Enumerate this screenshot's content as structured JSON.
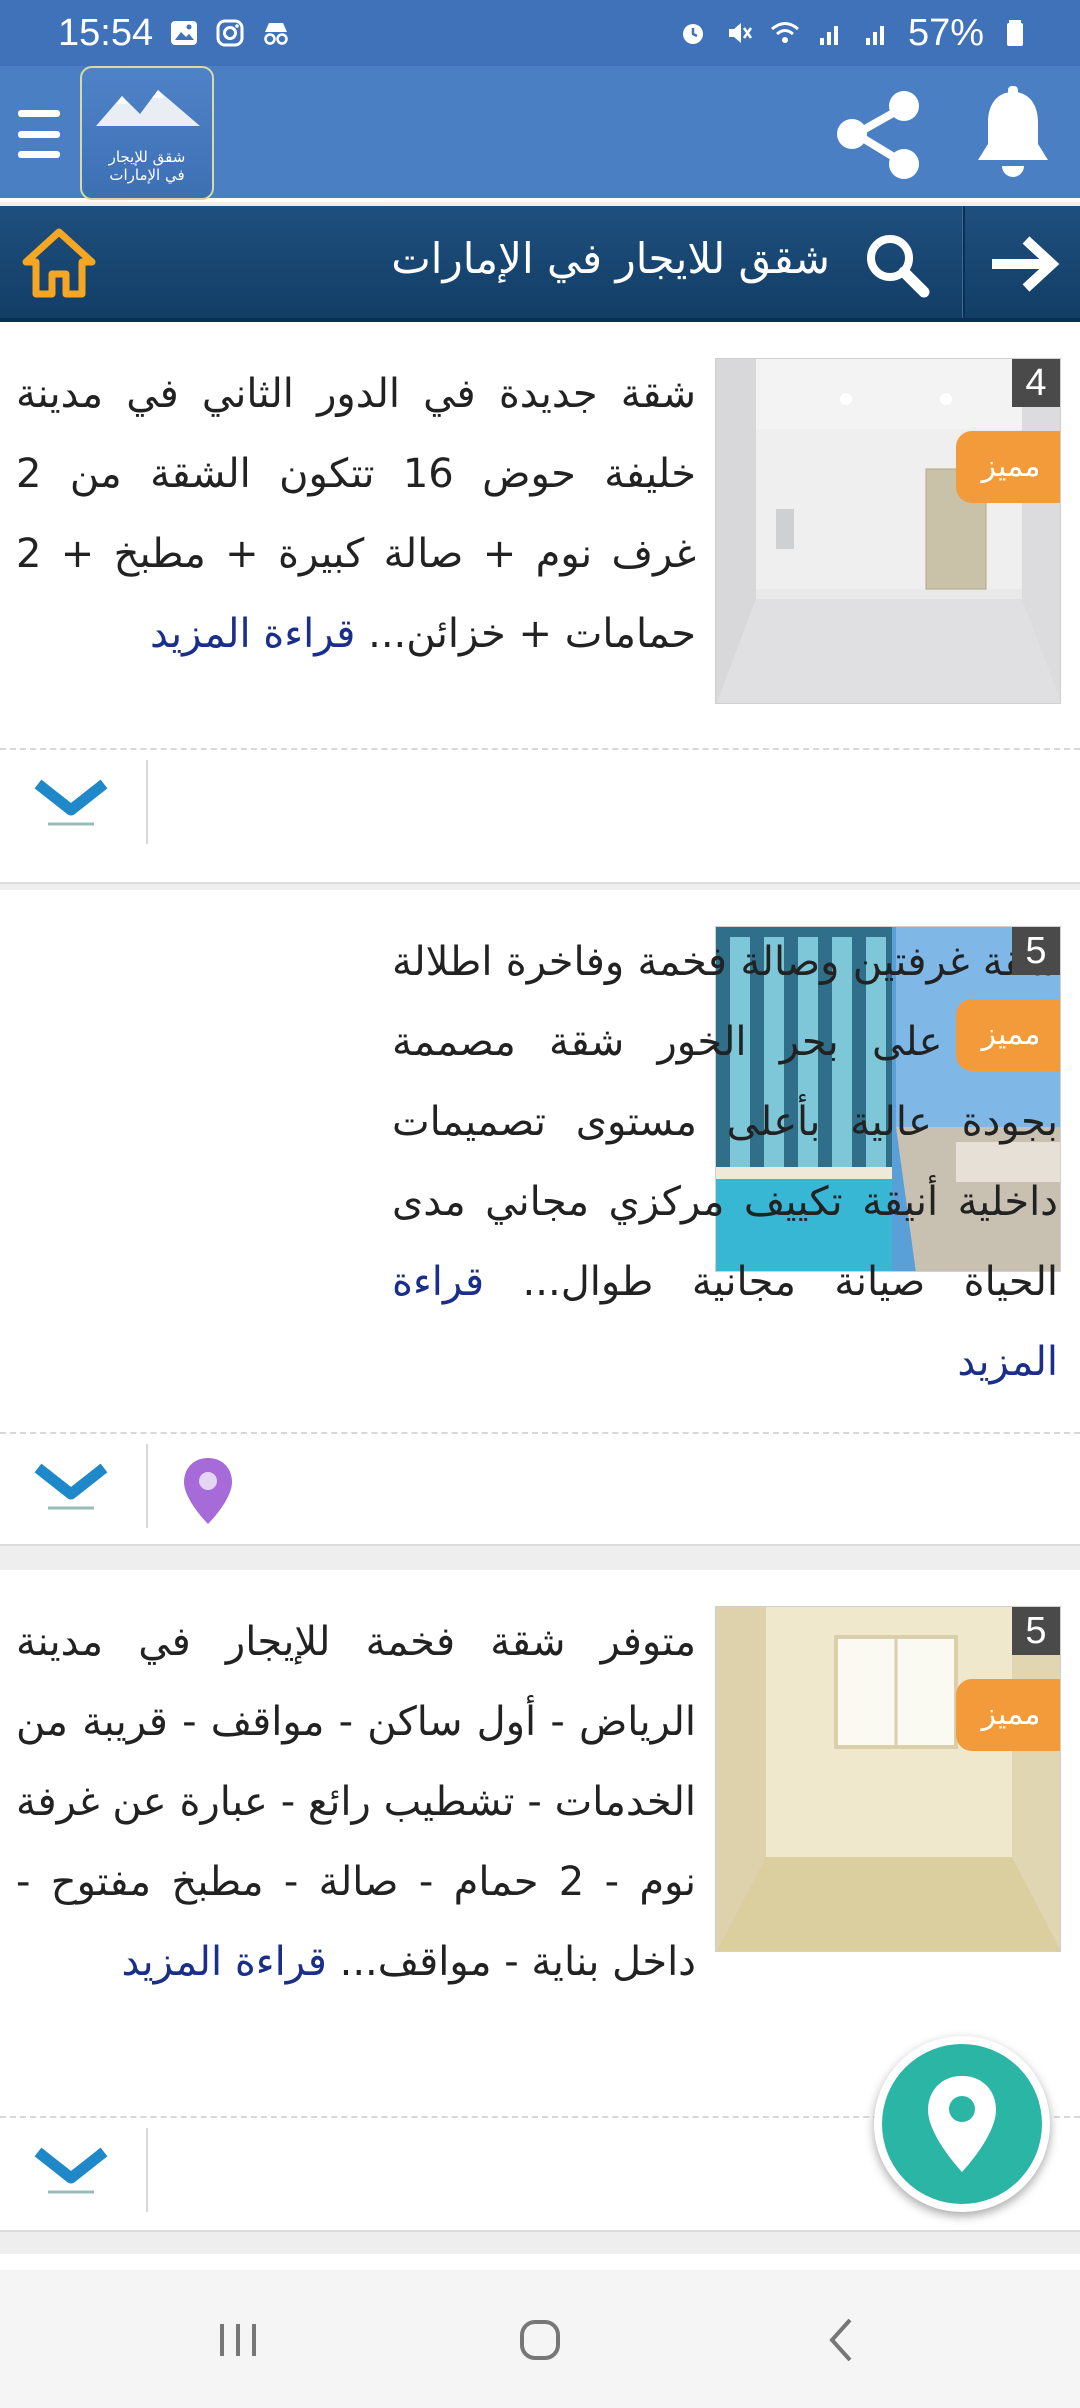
{
  "status_bar": {
    "time": "15:54",
    "battery": "57%"
  },
  "app_bar": {
    "logo_line1": "شقق للإيجار",
    "logo_line2": "في الإمارات"
  },
  "search_bar": {
    "title": "شقق للايجار في الإمارات"
  },
  "listings": [
    {
      "photo_count": "4",
      "featured_label": "مميز",
      "description": "شقة جديدة في الدور الثاني في مدينة خليفة حوض 16 تتكون الشقة من 2 غرف نوم + صالة كبيرة + مطبخ + 2 حمامات + خزائن...",
      "read_more": "قراءة المزيد"
    },
    {
      "photo_count": "5",
      "featured_label": "مميز",
      "description": "شقة غرفتين وصالة فخمة وفاخرة اطلالة رائعة على بحر الخور شقة مصممة بجودة عالية بأعلى مستوى تصميمات داخلية أنيقة تكييف مركزي مجاني مدى الحياة صيانة مجانية طوال...",
      "read_more": "قراءة المزيد"
    },
    {
      "photo_count": "5",
      "featured_label": "مميز",
      "description": "متوفر شقة فخمة للإيجار في مدينة الرياض - أول ساكن - مواقف - قريبة من الخدمات - تشطيب رائع - عبارة عن غرفة نوم - 2 حمام - صالة - مطبخ مفتوح - داخل بناية - مواقف...",
      "read_more": "قراءة المزيد"
    }
  ],
  "colors": {
    "app_bar": "#4a7fc4",
    "search_bar": "#1a4775",
    "featured": "#f39a3a",
    "fab": "#2bb5a5",
    "link": "#1a2f8a"
  }
}
